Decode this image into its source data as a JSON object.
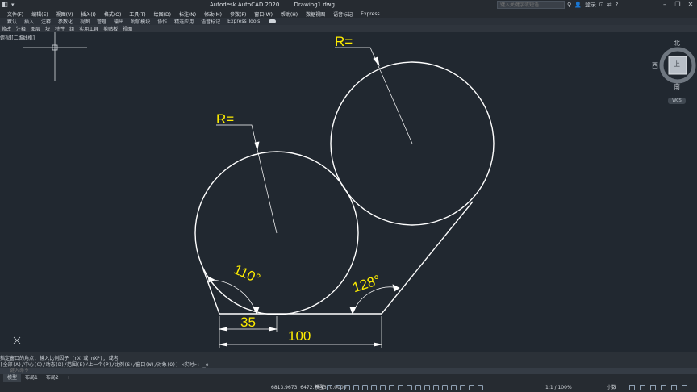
{
  "titlebar": {
    "app_title": "Autodesk AutoCAD 2020",
    "file_name": "Drawing1.dwg",
    "search_placeholder": "键入关键字或短语",
    "login": "登录"
  },
  "menu": [
    "文件(F)",
    "编辑(E)",
    "视图(V)",
    "插入(I)",
    "格式(O)",
    "工具(T)",
    "绘图(D)",
    "标注(N)",
    "修改(M)",
    "参数(P)",
    "窗口(W)",
    "帮助(H)",
    "数据视图",
    "语音标记",
    "Express"
  ],
  "ribbon_tabs": [
    "默认",
    "插入",
    "注释",
    "参数化",
    "视图",
    "管理",
    "输出",
    "附加模块",
    "协作",
    "精选应用",
    "语音标记",
    "Express Tools"
  ],
  "toolbar_items": [
    "修改",
    "注释",
    "图层",
    "块",
    "特性",
    "组",
    "实用工具",
    "剪贴板",
    "视图"
  ],
  "viewport_label": "俯视][二维线框]",
  "drawing": {
    "radius_label_1": "R=",
    "radius_label_2": "R=",
    "angle_1": "110°",
    "angle_2": "128°",
    "dim_35": "35",
    "dim_100": "100",
    "line_color": "#ffffff",
    "dim_color": "#ffee00"
  },
  "viewcube": {
    "north": "北",
    "south": "南",
    "west": "西",
    "top_face": "上",
    "wcs": "WCS"
  },
  "command": {
    "history_1": "指定窗口的角点, 输入比例因子 (nX 或 nXP), 或者",
    "history_2": "[全部(A)/中心(C)/动态(D)/范围(E)/上一个(P)/比例(S)/窗口(W)/对象(O)] <实时>: _e",
    "input_placeholder": "键入命令"
  },
  "layouts": [
    "模型",
    "布局1",
    "布局2",
    "+"
  ],
  "status": {
    "coords": "6813.9673, 6472.7443, 0.0000",
    "model": "模型",
    "scale": "1:1 / 100%",
    "units": "小数"
  }
}
